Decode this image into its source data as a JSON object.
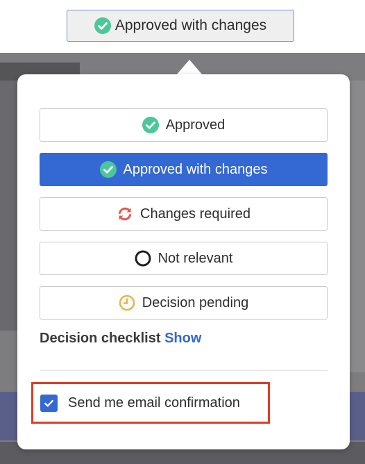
{
  "top_button": {
    "label": "Approved with changes",
    "icon": "check-circle-icon"
  },
  "status_options": [
    {
      "label": "Approved",
      "icon": "check-circle-icon",
      "selected": false
    },
    {
      "label": "Approved with changes",
      "icon": "check-circle-icon",
      "selected": true
    },
    {
      "label": "Changes required",
      "icon": "refresh-icon",
      "selected": false
    },
    {
      "label": "Not relevant",
      "icon": "empty-circle-icon",
      "selected": false
    },
    {
      "label": "Decision pending",
      "icon": "clock-icon",
      "selected": false
    }
  ],
  "checklist": {
    "label": "Decision checklist",
    "link": "Show"
  },
  "email_confirmation": {
    "label": "Send me email confirmation",
    "checked": true
  },
  "colors": {
    "accent": "#3468d2",
    "approved_green": "#4cc79a",
    "changes_red": "#e8564a",
    "pending_yellow": "#e8b54a",
    "highlight_border": "#e03c28"
  }
}
